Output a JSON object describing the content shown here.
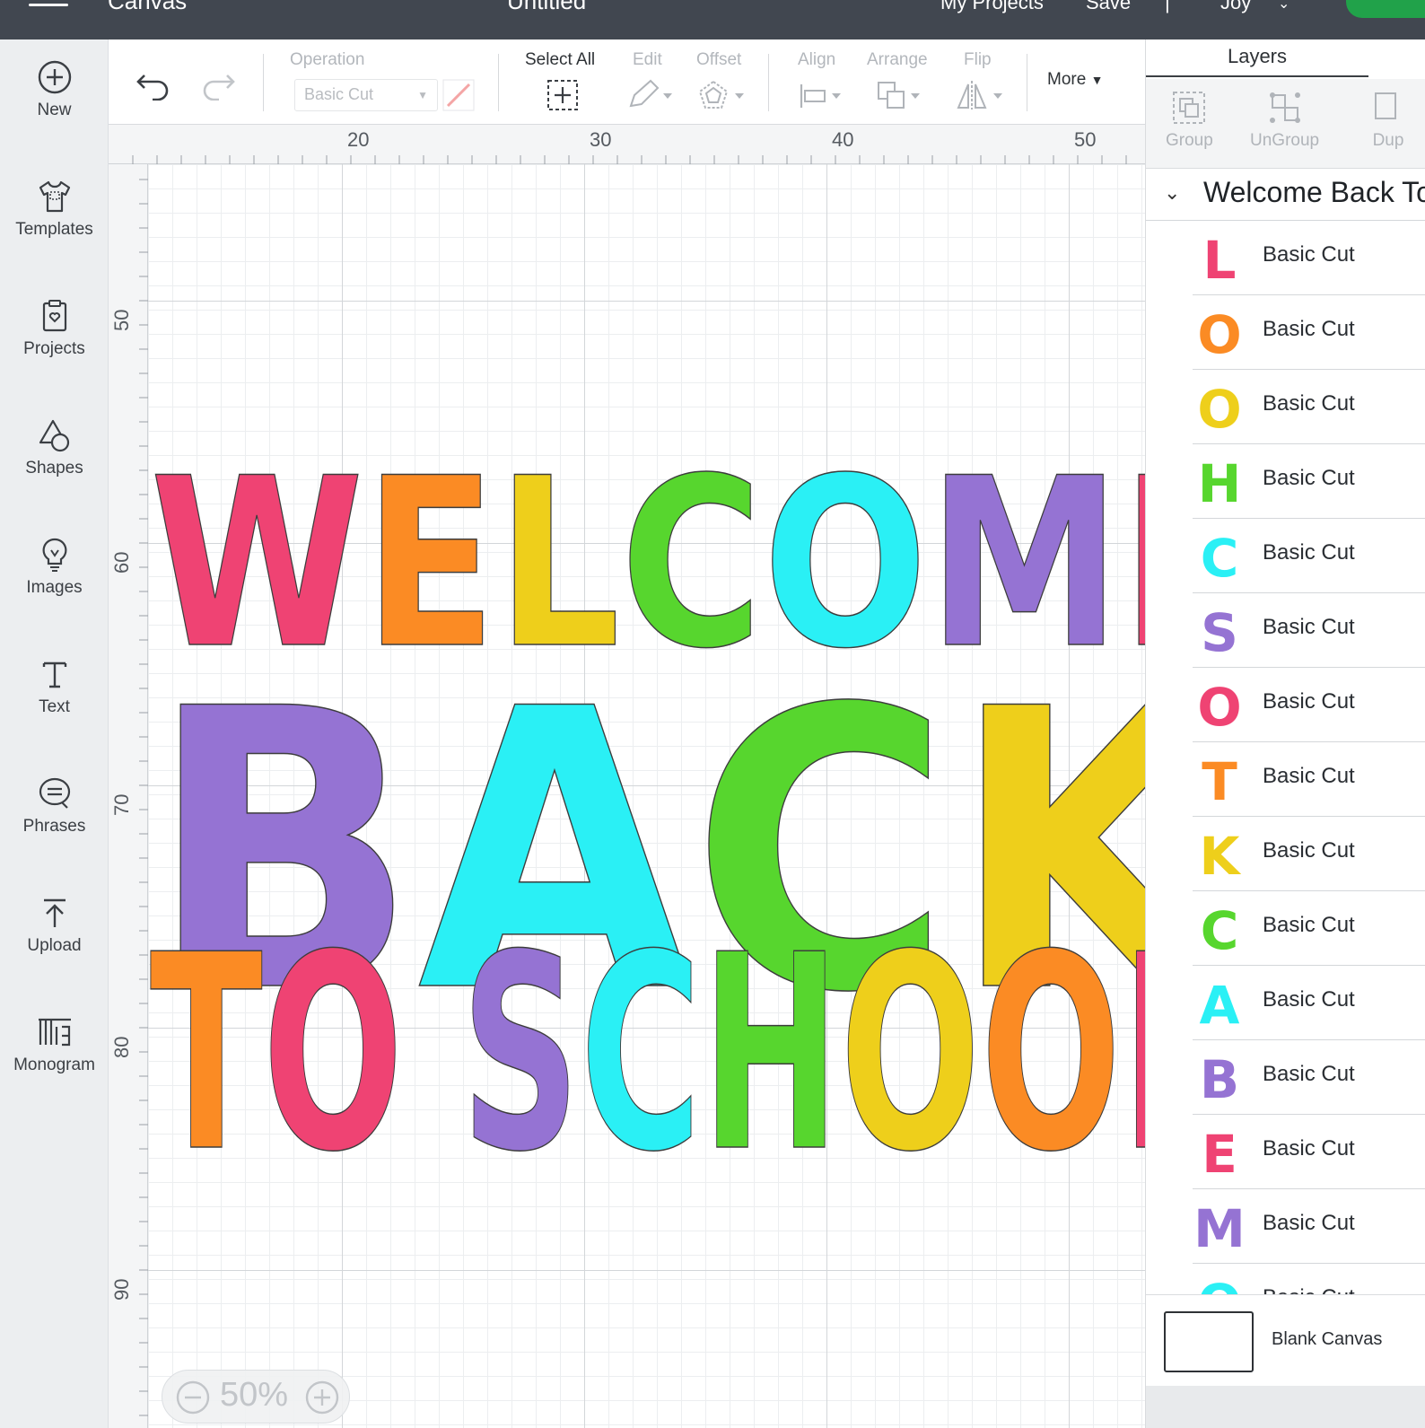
{
  "topbar": {
    "app_title": "Canvas",
    "doc_title": "Untitled",
    "my_projects": "My Projects",
    "save": "Save",
    "divider": "|",
    "user": "Joy",
    "accent": "#21a24a",
    "background": "#414750"
  },
  "sidebar": {
    "items": [
      {
        "label": "New",
        "icon": "plus-circle-icon"
      },
      {
        "label": "Templates",
        "icon": "tshirt-icon"
      },
      {
        "label": "Projects",
        "icon": "projects-icon"
      },
      {
        "label": "Shapes",
        "icon": "shapes-icon"
      },
      {
        "label": "Images",
        "icon": "lightbulb-icon"
      },
      {
        "label": "Text",
        "icon": "text-t-icon"
      },
      {
        "label": "Phrases",
        "icon": "speech-bubble-icon"
      },
      {
        "label": "Upload",
        "icon": "upload-icon"
      },
      {
        "label": "Monogram",
        "icon": "monogram-icon"
      }
    ]
  },
  "toolbar": {
    "operation_label": "Operation",
    "operation_value": "Basic Cut",
    "select_all": "Select All",
    "edit": "Edit",
    "offset": "Offset",
    "align": "Align",
    "arrange": "Arrange",
    "flip": "Flip",
    "more": "More"
  },
  "rulers": {
    "top": [
      "20",
      "30",
      "40",
      "50"
    ],
    "left": [
      "50",
      "60",
      "70",
      "80",
      "90"
    ]
  },
  "canvas": {
    "zoom": "50%",
    "text_line1": "WELCOME",
    "text_line2": "BACK",
    "text_line3": "TO SCHOOL",
    "colors": {
      "pink": "#ef4373",
      "orange": "#fb8b24",
      "yellow": "#eecf1b",
      "green": "#57d62e",
      "cyan": "#2af0f5",
      "purple": "#9573d3"
    }
  },
  "layers": {
    "tab": "Layers",
    "tools": [
      "Group",
      "UnGroup",
      "Dup"
    ],
    "group_title": "Welcome Back To",
    "items": [
      {
        "glyph": "L",
        "color": "#ef4373",
        "label": "Basic Cut"
      },
      {
        "glyph": "O",
        "color": "#fb8b24",
        "label": "Basic Cut"
      },
      {
        "glyph": "O",
        "color": "#eecf1b",
        "label": "Basic Cut"
      },
      {
        "glyph": "H",
        "color": "#57d62e",
        "label": "Basic Cut"
      },
      {
        "glyph": "C",
        "color": "#2af0f5",
        "label": "Basic Cut"
      },
      {
        "glyph": "S",
        "color": "#9573d3",
        "label": "Basic Cut"
      },
      {
        "glyph": "O",
        "color": "#ef4373",
        "label": "Basic Cut"
      },
      {
        "glyph": "T",
        "color": "#fb8b24",
        "label": "Basic Cut"
      },
      {
        "glyph": "K",
        "color": "#eecf1b",
        "label": "Basic Cut"
      },
      {
        "glyph": "C",
        "color": "#57d62e",
        "label": "Basic Cut"
      },
      {
        "glyph": "A",
        "color": "#2af0f5",
        "label": "Basic Cut"
      },
      {
        "glyph": "B",
        "color": "#9573d3",
        "label": "Basic Cut"
      },
      {
        "glyph": "E",
        "color": "#ef4373",
        "label": "Basic Cut"
      },
      {
        "glyph": "M",
        "color": "#9573d3",
        "label": "Basic Cut"
      },
      {
        "glyph": "O",
        "color": "#2af0f5",
        "label": "Basic Cut"
      }
    ],
    "blank_canvas": "Blank Canvas"
  }
}
